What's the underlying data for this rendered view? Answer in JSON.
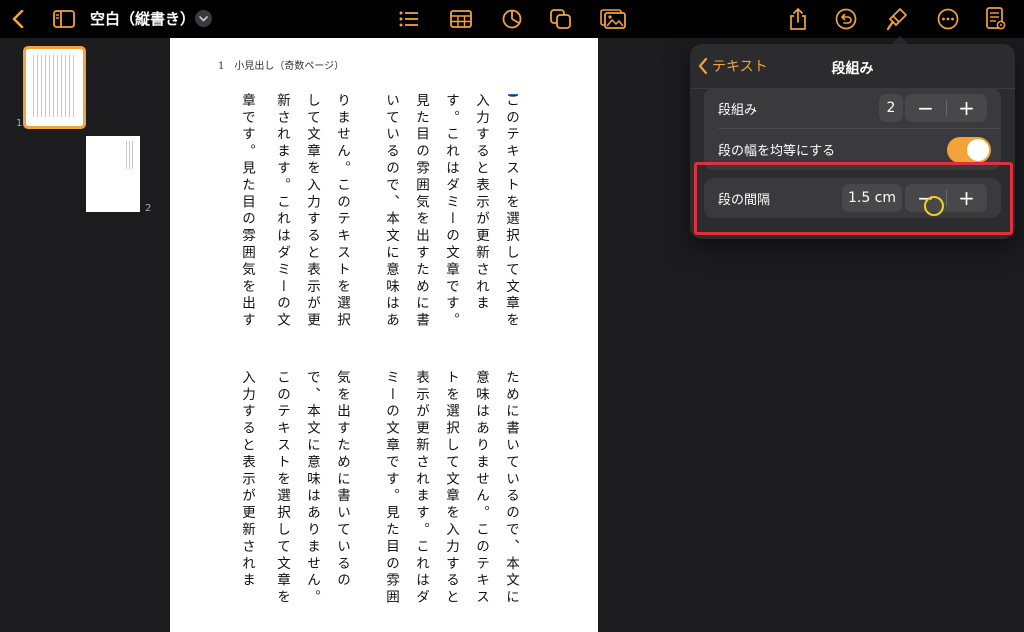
{
  "toolbar": {
    "doc_title": "空白（縦書き）",
    "colors": {
      "accent": "#f2a33a",
      "background": "#000000"
    },
    "left_icons": [
      "back-chevron-icon",
      "sidebar-icon",
      "title-menu-chevron-icon"
    ],
    "center_icons": [
      "list-icon",
      "table-icon",
      "chart-icon",
      "shape-icon",
      "media-icon"
    ],
    "right_icons": [
      "share-icon",
      "undo-icon",
      "format-brush-icon",
      "more-icon",
      "document-setup-icon"
    ]
  },
  "sidebar": {
    "thumbnails": [
      {
        "page": "1",
        "selected": true
      },
      {
        "page": "2",
        "selected": false
      }
    ]
  },
  "page": {
    "header": "1　小見出し（奇数ページ）",
    "columns_top": [
      "このテキストを選択して文章を",
      "入力すると表示が更新されま",
      "す。これはダミーの文章です。",
      "見た目の雰囲気を出すために書",
      "いているので、本文に意味はあ",
      "りません。このテキストを選択",
      "して文章を入力すると表示が更",
      "新されます。これはダミーの文",
      "章です。見た目の雰囲気を出す"
    ],
    "columns_bottom": [
      "ために書いているので、本文に",
      "意味はありません。このテキス",
      "トを選択して文章を入力すると",
      "表示が更新されます。これはダ",
      "ミーの文章です。見た目の雰囲",
      "気を出すために書いているの",
      "で、本文に意味はありません。",
      "このテキストを選択して文章を",
      "入力すると表示が更新されま"
    ]
  },
  "popover": {
    "back_label": "テキスト",
    "title": "段組み",
    "columns_label": "段組み",
    "columns_value": "2",
    "equal_width_label": "段の幅を均等にする",
    "equal_width_on": true,
    "gap_label": "段の間隔",
    "gap_value": "1.5 cm",
    "minus": "−",
    "plus": "+"
  }
}
